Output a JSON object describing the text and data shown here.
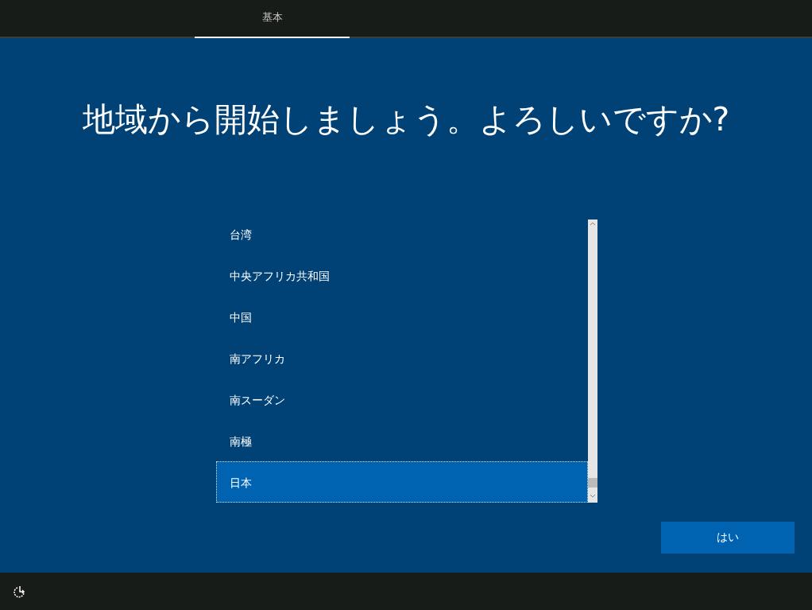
{
  "tabs": [
    {
      "label": "基本",
      "selected": true
    }
  ],
  "title": "地域から開始しましょう。よろしいですか?",
  "regions": [
    {
      "name": "台湾",
      "selected": false
    },
    {
      "name": "中央アフリカ共和国",
      "selected": false
    },
    {
      "name": "中国",
      "selected": false
    },
    {
      "name": "南アフリカ",
      "selected": false
    },
    {
      "name": "南スーダン",
      "selected": false
    },
    {
      "name": "南極",
      "selected": false
    },
    {
      "name": "日本",
      "selected": true
    }
  ],
  "buttons": [
    "はい"
  ]
}
